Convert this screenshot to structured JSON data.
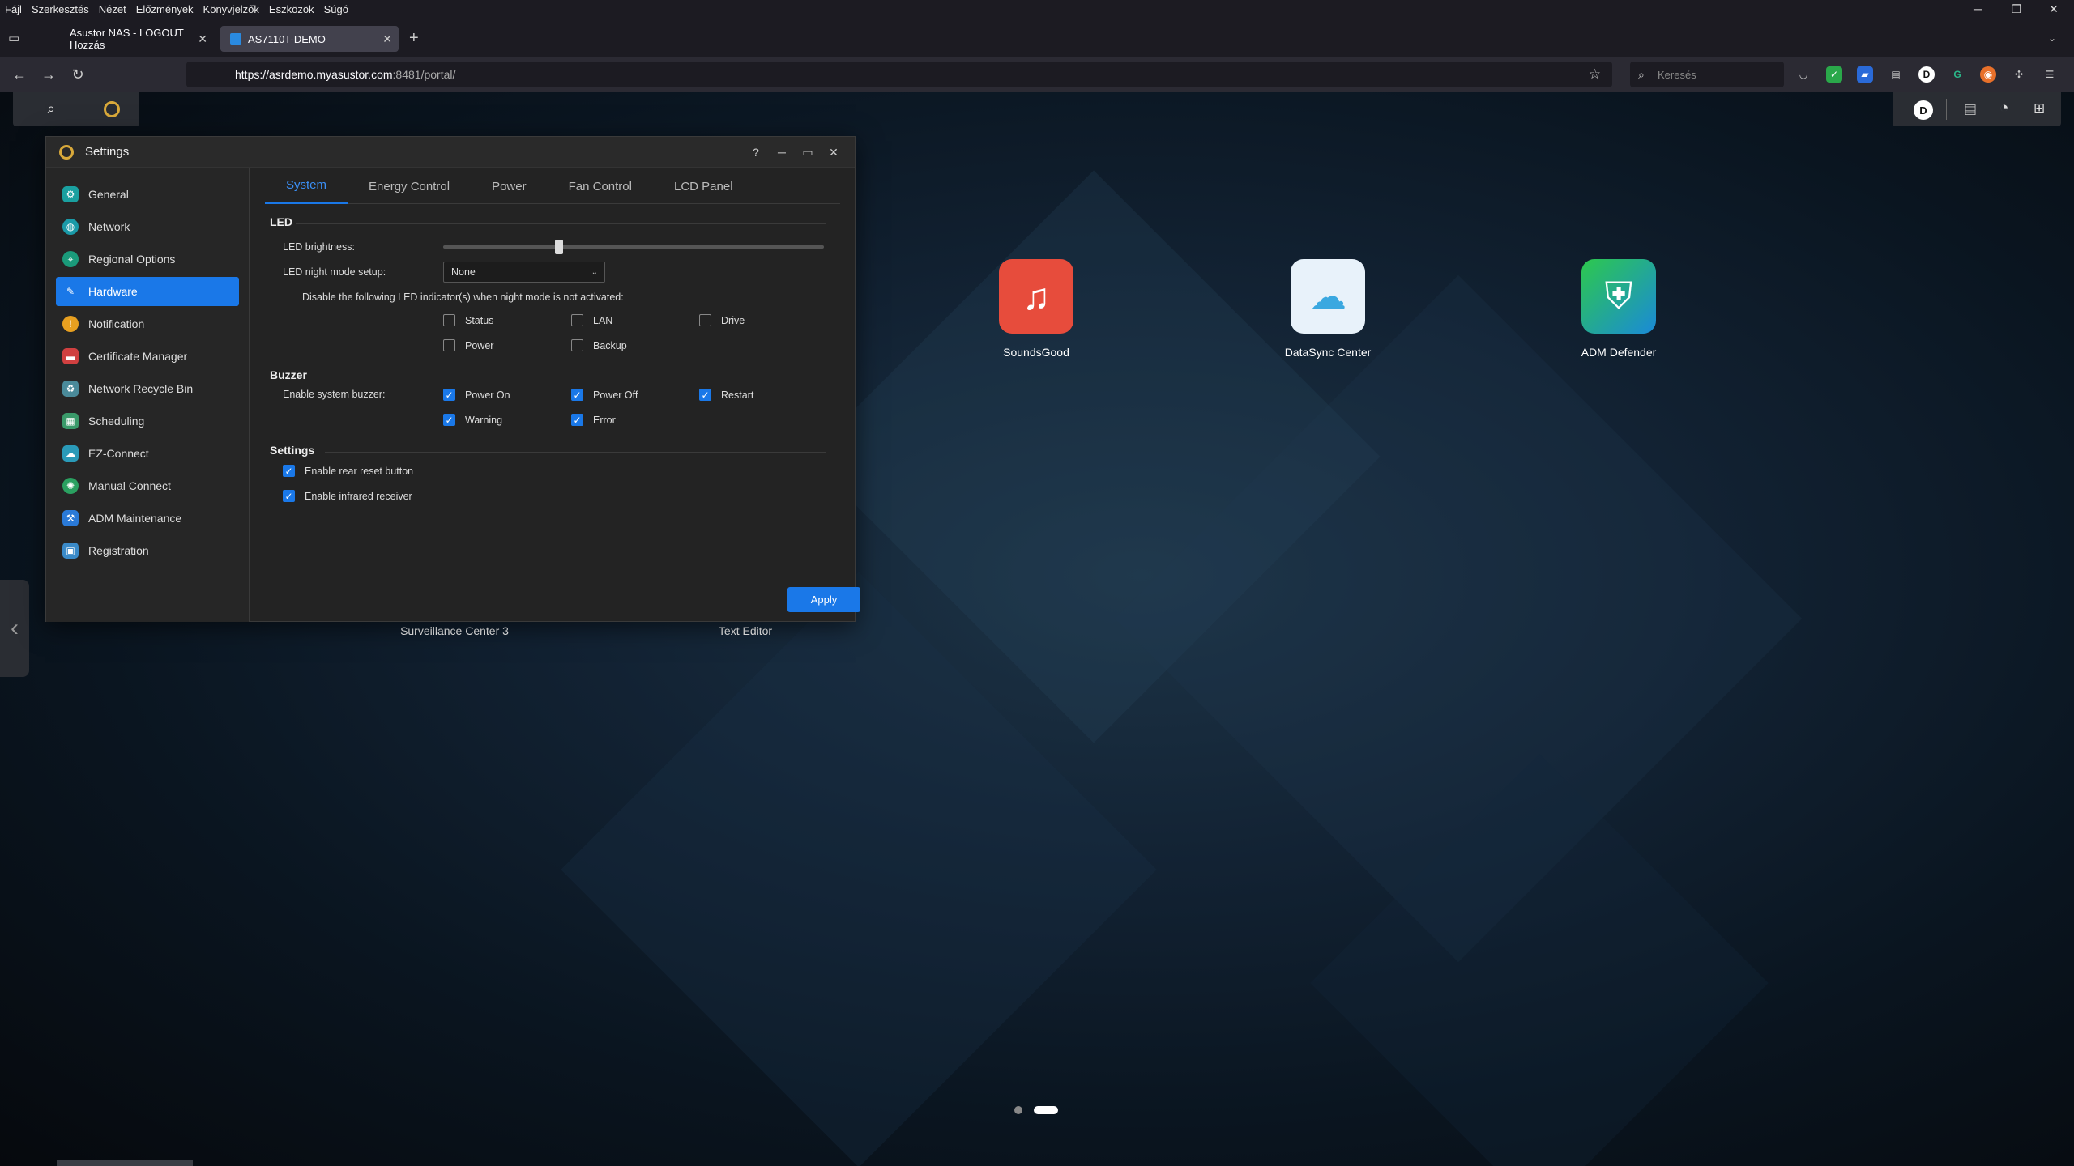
{
  "browser": {
    "menu": [
      "Fájl",
      "Szerkesztés",
      "Nézet",
      "Előzmények",
      "Könyvjelzők",
      "Eszközök",
      "Súgó"
    ],
    "tabs": [
      {
        "title": "Asustor NAS - LOGOUT Hozzás"
      },
      {
        "title": "AS7110T-DEMO"
      }
    ],
    "url_host": "https://asrdemo.myasustor.com",
    "url_path": ":8481/portal/",
    "search_placeholder": "Keresés"
  },
  "desktop": {
    "apps": [
      {
        "label": "SoundsGood",
        "color": "#e74c3c"
      },
      {
        "label": "DataSync Center",
        "color": "#e8f2fa"
      },
      {
        "label": "ADM Defender",
        "color": "#2db84d"
      },
      {
        "label": "Surveillance Center 3",
        "color": "#2b2b2b"
      },
      {
        "label": "Text Editor",
        "color": "#9aa1aa"
      }
    ]
  },
  "settings": {
    "title": "Settings",
    "sidebar": [
      {
        "label": "General",
        "color": "#1aa0a0"
      },
      {
        "label": "Network",
        "color": "#1a9aa8"
      },
      {
        "label": "Regional Options",
        "color": "#1a9a7a"
      },
      {
        "label": "Hardware",
        "color": "#1a78e8",
        "active": true
      },
      {
        "label": "Notification",
        "color": "#e8a020"
      },
      {
        "label": "Certificate Manager",
        "color": "#d04040"
      },
      {
        "label": "Network Recycle Bin",
        "color": "#4a8a9a"
      },
      {
        "label": "Scheduling",
        "color": "#3a9a6a"
      },
      {
        "label": "EZ-Connect",
        "color": "#2a9ab8"
      },
      {
        "label": "Manual Connect",
        "color": "#2aa060"
      },
      {
        "label": "ADM Maintenance",
        "color": "#2a7ad8"
      },
      {
        "label": "Registration",
        "color": "#3a8ac8"
      }
    ],
    "tabs": [
      "System",
      "Energy Control",
      "Power",
      "Fan Control",
      "LCD Panel"
    ],
    "led": {
      "heading": "LED",
      "brightness_label": "LED brightness:",
      "brightness_fraction": 0.3,
      "night_mode_label": "LED night mode setup:",
      "night_mode_value": "None",
      "disable_text": "Disable the following LED indicator(s) when night mode is not activated:",
      "indicators": [
        {
          "label": "Status",
          "checked": false
        },
        {
          "label": "LAN",
          "checked": false
        },
        {
          "label": "Drive",
          "checked": false
        },
        {
          "label": "Power",
          "checked": false
        },
        {
          "label": "Backup",
          "checked": false
        }
      ]
    },
    "buzzer": {
      "heading": "Buzzer",
      "label": "Enable system buzzer:",
      "options": [
        {
          "label": "Power On",
          "checked": true
        },
        {
          "label": "Power Off",
          "checked": true
        },
        {
          "label": "Restart",
          "checked": true
        },
        {
          "label": "Warning",
          "checked": true
        },
        {
          "label": "Error",
          "checked": true
        }
      ]
    },
    "settings_section": {
      "heading": "Settings",
      "options": [
        {
          "label": "Enable rear reset button",
          "checked": true
        },
        {
          "label": "Enable infrared receiver",
          "checked": true
        }
      ]
    },
    "apply_label": "Apply"
  }
}
